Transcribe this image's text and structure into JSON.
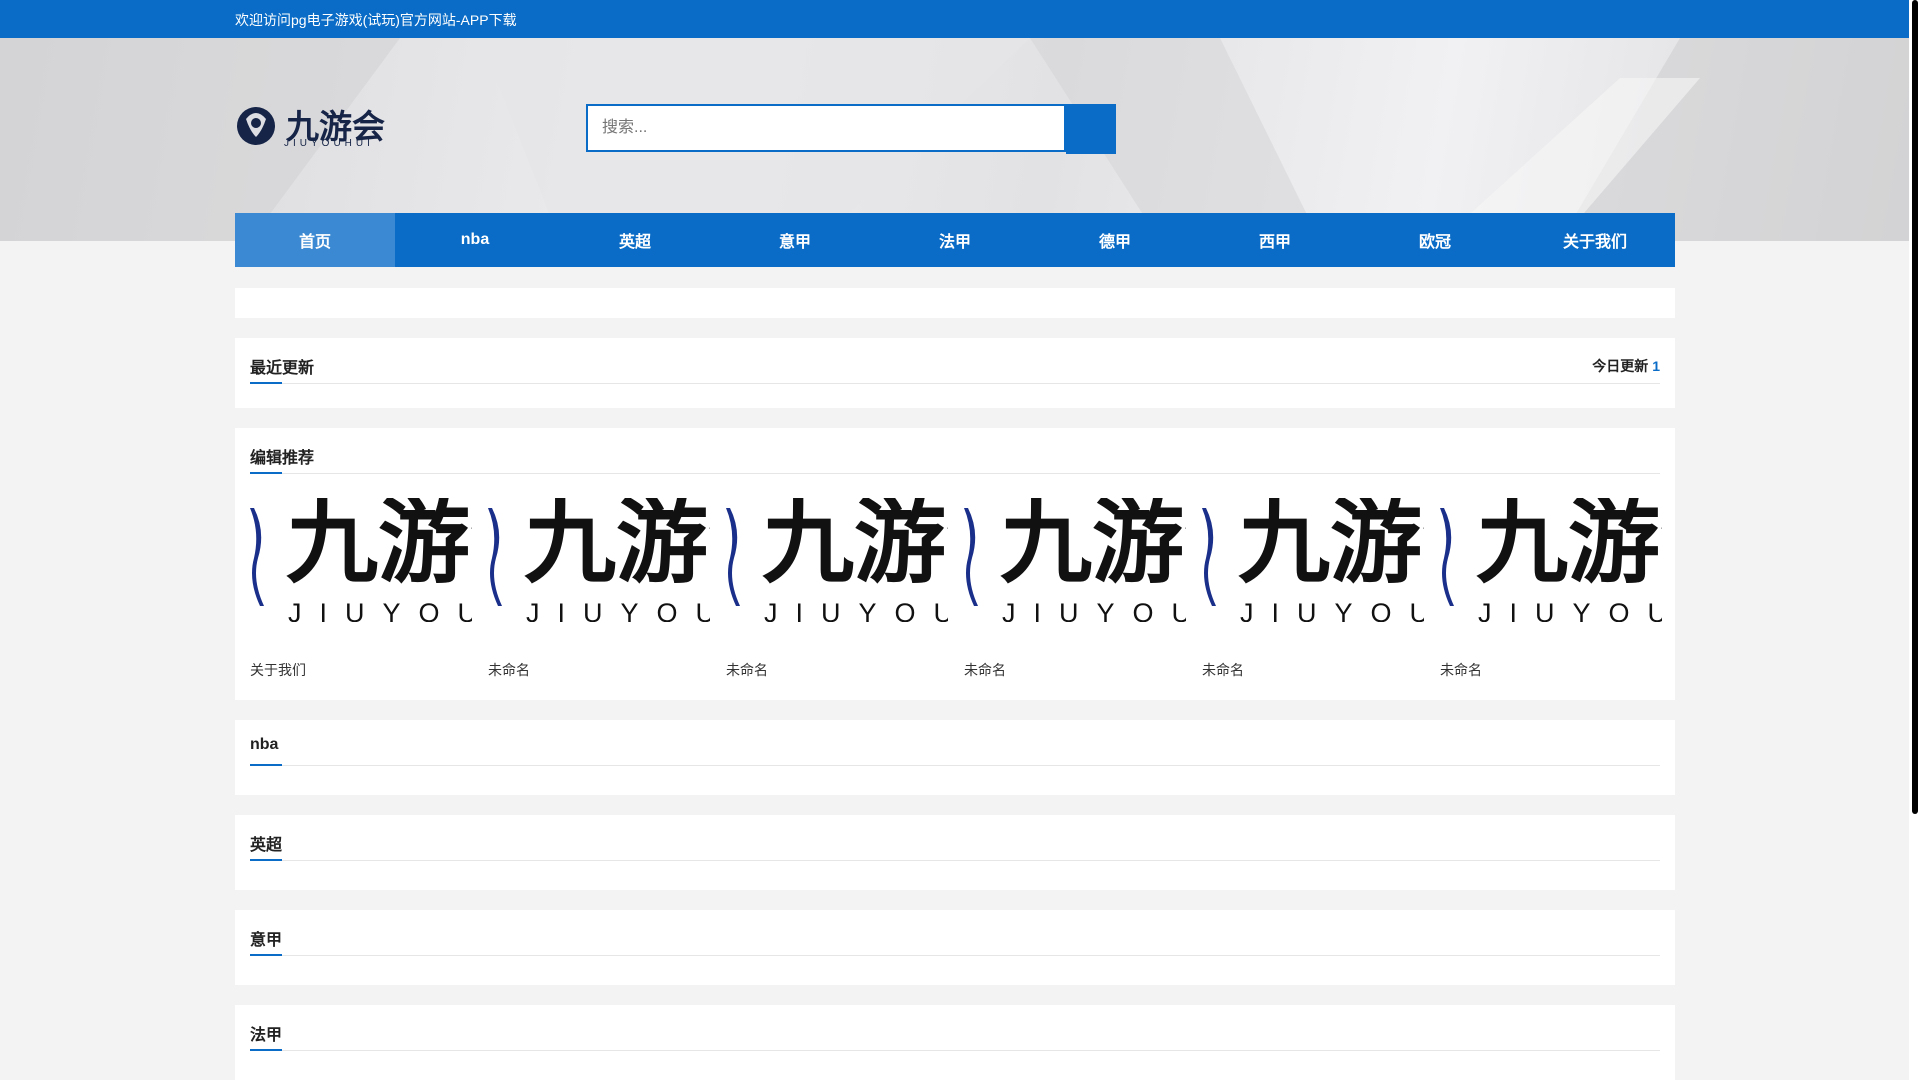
{
  "topbar": {
    "welcome": "欢迎访问pg电子游戏(试玩)官方网站-APP下载"
  },
  "logo": {
    "text": "九游会",
    "sub": "JIUYOUHUI"
  },
  "search": {
    "placeholder": "搜索..."
  },
  "nav": [
    {
      "label": "首页",
      "active": true
    },
    {
      "label": "nba"
    },
    {
      "label": "英超"
    },
    {
      "label": "意甲"
    },
    {
      "label": "法甲"
    },
    {
      "label": "德甲"
    },
    {
      "label": "西甲"
    },
    {
      "label": "欧冠"
    },
    {
      "label": "关于我们"
    }
  ],
  "recent": {
    "title": "最近更新",
    "today_label": "今日更新",
    "today_count": "1"
  },
  "editor": {
    "title": "编辑推荐",
    "thumb_text": "九游会",
    "thumb_sub": "JIUYOUHUI",
    "items": [
      "关于我们",
      "未命名",
      "未命名",
      "未命名",
      "未命名",
      "未命名"
    ]
  },
  "sections": [
    "nba",
    "英超",
    "意甲",
    "法甲"
  ],
  "colors": {
    "brand": "#0a6cc6",
    "nav_active": "#3a89d2"
  }
}
